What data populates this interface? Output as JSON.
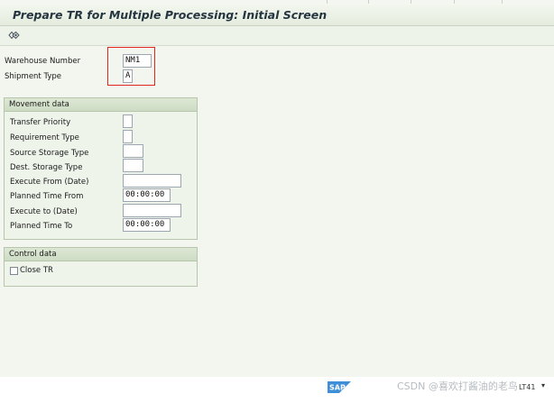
{
  "window": {
    "title": "Prepare TR for Multiple Processing: Initial Screen"
  },
  "toolbar": {
    "execute_icon": "execute-icon"
  },
  "header_fields": {
    "warehouse_number": {
      "label": "Warehouse Number",
      "value": "NM1"
    },
    "shipment_type": {
      "label": "Shipment Type",
      "value": "A"
    }
  },
  "movement": {
    "title": "Movement data",
    "transfer_priority": {
      "label": "Transfer Priority",
      "value": ""
    },
    "requirement_type": {
      "label": "Requirement Type",
      "value": ""
    },
    "source_storage_type": {
      "label": "Source Storage Type",
      "value": ""
    },
    "dest_storage_type": {
      "label": "Dest. Storage Type",
      "value": ""
    },
    "execute_from": {
      "label": "Execute From (Date)",
      "value": ""
    },
    "planned_time_from": {
      "label": "Planned Time From",
      "value": "00:00:00"
    },
    "execute_to": {
      "label": "Execute to (Date)",
      "value": ""
    },
    "planned_time_to": {
      "label": "Planned Time To",
      "value": "00:00:00"
    }
  },
  "control": {
    "title": "Control data",
    "close_tr": {
      "label": "Close TR",
      "checked": false
    }
  },
  "footer": {
    "sap_logo": "SAP",
    "watermark": "CSDN @喜欢打酱油的老鸟",
    "transaction": "LT41",
    "menu_icon": "triangle-down-icon",
    "menu_glyph": "▾"
  },
  "colors": {
    "highlight": "#e0261e",
    "background": "#f2f6ee",
    "group_header": "#d6e2cc"
  }
}
